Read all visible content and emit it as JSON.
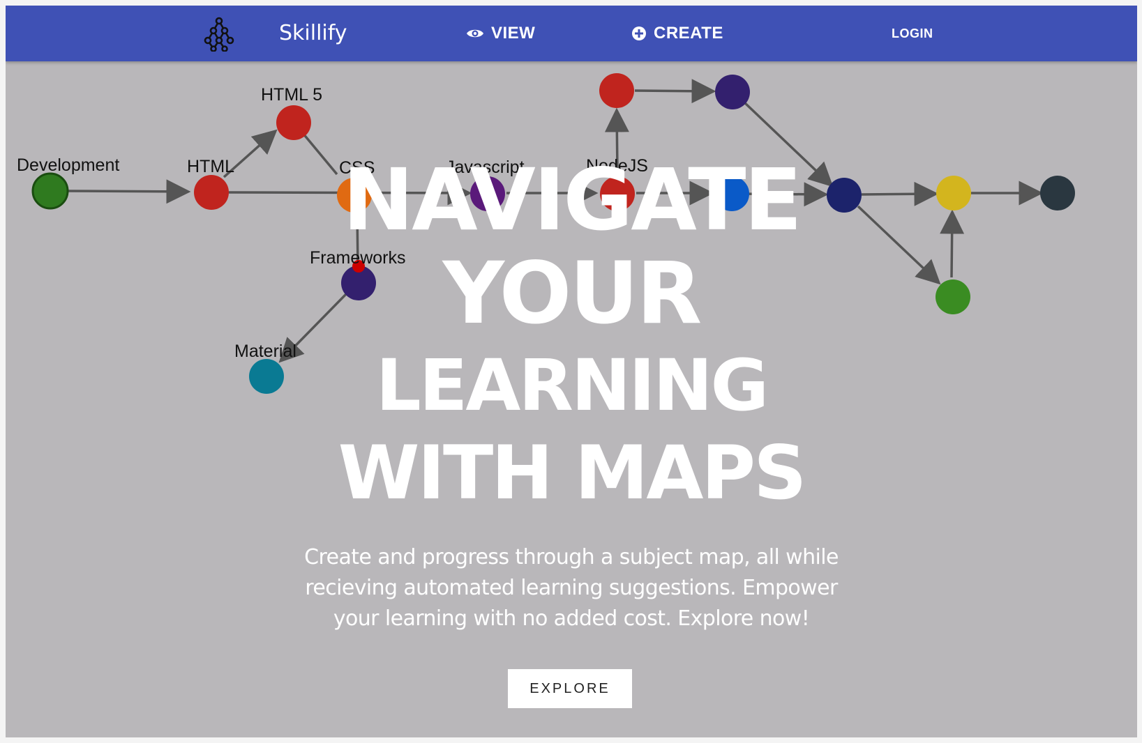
{
  "navbar": {
    "brand": "Skillify",
    "view_label": "VIEW",
    "create_label": "CREATE",
    "login_label": "LOGIN",
    "color": "#3f51b5"
  },
  "map": {
    "labels": {
      "development": "Development",
      "html": "HTML",
      "html5": "HTML 5",
      "css": "CSS",
      "javascript": "Javascript",
      "nodejs": "NodeJS",
      "frameworks": "Frameworks",
      "material": "Material"
    }
  },
  "hero": {
    "line1": "NAVIGATE",
    "line2": "YOUR",
    "line3": "LEARNING",
    "line4": "WITH MAPS",
    "subtitle": "Create and progress through a subject map, all while recieving automated learning suggestions. Empower your learning with no added cost. Explore now!",
    "cta_label": "EXPLORE"
  }
}
